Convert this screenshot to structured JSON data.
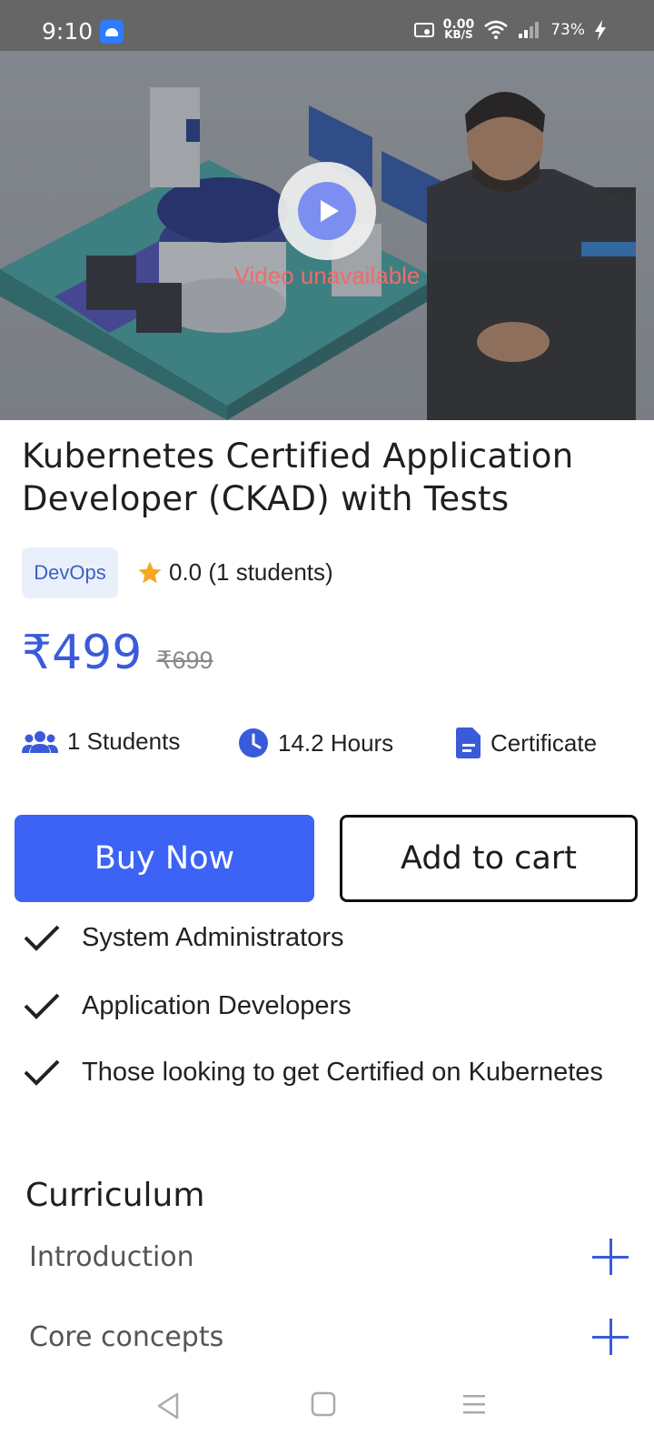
{
  "status_bar": {
    "time": "9:10",
    "net_speed_value": "0.00",
    "net_speed_unit": "KB/S",
    "battery": "73%",
    "icons": [
      "android-icon",
      "rec-icon",
      "wifi-icon",
      "signal-icon",
      "charging-icon"
    ]
  },
  "video": {
    "status_text": "Video unavailable",
    "play_icon": "play-icon"
  },
  "course": {
    "title": "Kubernetes Certified Application Developer (CKAD) with Tests",
    "category": "DevOps",
    "rating": "0.0 (1 students)",
    "price_now": "₹499",
    "price_old": "₹699"
  },
  "stats": [
    {
      "icon": "students-icon",
      "label": "1 Students"
    },
    {
      "icon": "clock-icon",
      "label": "14.2 Hours"
    },
    {
      "icon": "document-icon",
      "label": "Certificate"
    }
  ],
  "actions": {
    "buy_label": "Buy Now",
    "cart_label": "Add to cart"
  },
  "audience": [
    "System Administrators",
    "Application Developers",
    "Those looking to get Certified on Kubernetes"
  ],
  "curriculum": {
    "heading": "Curriculum",
    "sections": [
      "Introduction",
      "Core concepts"
    ]
  },
  "colors": {
    "accent": "#3c63f5",
    "price": "#3a5bd9",
    "chip_bg": "#eaf0fb",
    "error_text": "#f06b6b",
    "star": "#f5a623"
  }
}
